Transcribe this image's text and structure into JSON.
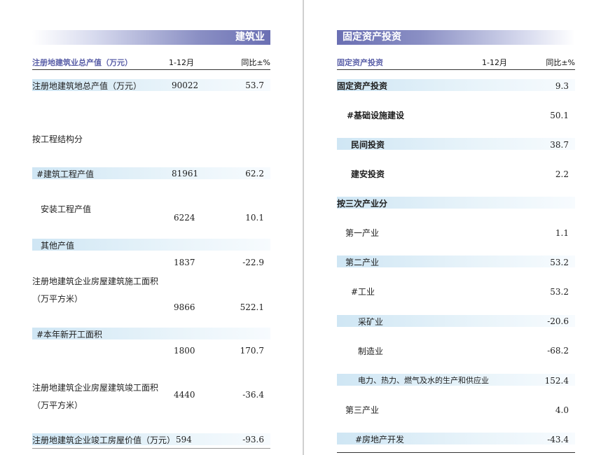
{
  "left": {
    "banner": "建筑业",
    "header": {
      "indicator": "注册地建筑业总产值（万元）",
      "period": "1-12月",
      "yoy": "同比±%"
    },
    "rows": [
      {
        "label": "注册地建筑地总产值（万元）",
        "value": "90022",
        "yoy": "53.7"
      },
      {
        "label": "按工程结构分",
        "value": "",
        "yoy": ""
      },
      {
        "label": "#建筑工程产值",
        "value": "81961",
        "yoy": "62.2"
      },
      {
        "label": "安装工程产值",
        "value": "6224",
        "yoy": "10.1"
      },
      {
        "label": "其他产值",
        "value": "1837",
        "yoy": "-22.9"
      },
      {
        "label": "注册地建筑企业房屋建筑施工面积",
        "label2": "（万平方米）",
        "value": "9866",
        "yoy": "522.1"
      },
      {
        "label": "#本年新开工面积",
        "value": "1800",
        "yoy": "170.7"
      },
      {
        "label": "注册地建筑企业房屋建筑竣工面积",
        "label2": "（万平方米）",
        "value": "4440",
        "yoy": "-36.4"
      },
      {
        "label": "注册地建筑企业竣工房屋价值（万元）",
        "value": "594",
        "yoy": "-93.6"
      }
    ]
  },
  "right": {
    "banner": "固定资产投资",
    "header": {
      "indicator": "固定资产投资",
      "period": "1-12月",
      "yoy": "同比±%"
    },
    "rows": [
      {
        "label": "固定资产投资",
        "yoy": "9.3"
      },
      {
        "label": "#基础设施建设",
        "yoy": "50.1"
      },
      {
        "label": "民间投资",
        "yoy": "38.7"
      },
      {
        "label": "建安投资",
        "yoy": "2.2"
      },
      {
        "label": "按三次产业分",
        "yoy": ""
      },
      {
        "label": "第一产业",
        "yoy": "1.1"
      },
      {
        "label": "第二产业",
        "yoy": "53.2"
      },
      {
        "label": "#工业",
        "yoy": "53.2"
      },
      {
        "label": "采矿业",
        "yoy": "-20.6"
      },
      {
        "label": "制造业",
        "yoy": "-68.2"
      },
      {
        "label": "电力、热力、燃气及水的生产和供应业",
        "yoy": "152.4"
      },
      {
        "label": "第三产业",
        "yoy": "4.0"
      },
      {
        "label": "#房地产开发",
        "yoy": "-43.4"
      }
    ]
  }
}
